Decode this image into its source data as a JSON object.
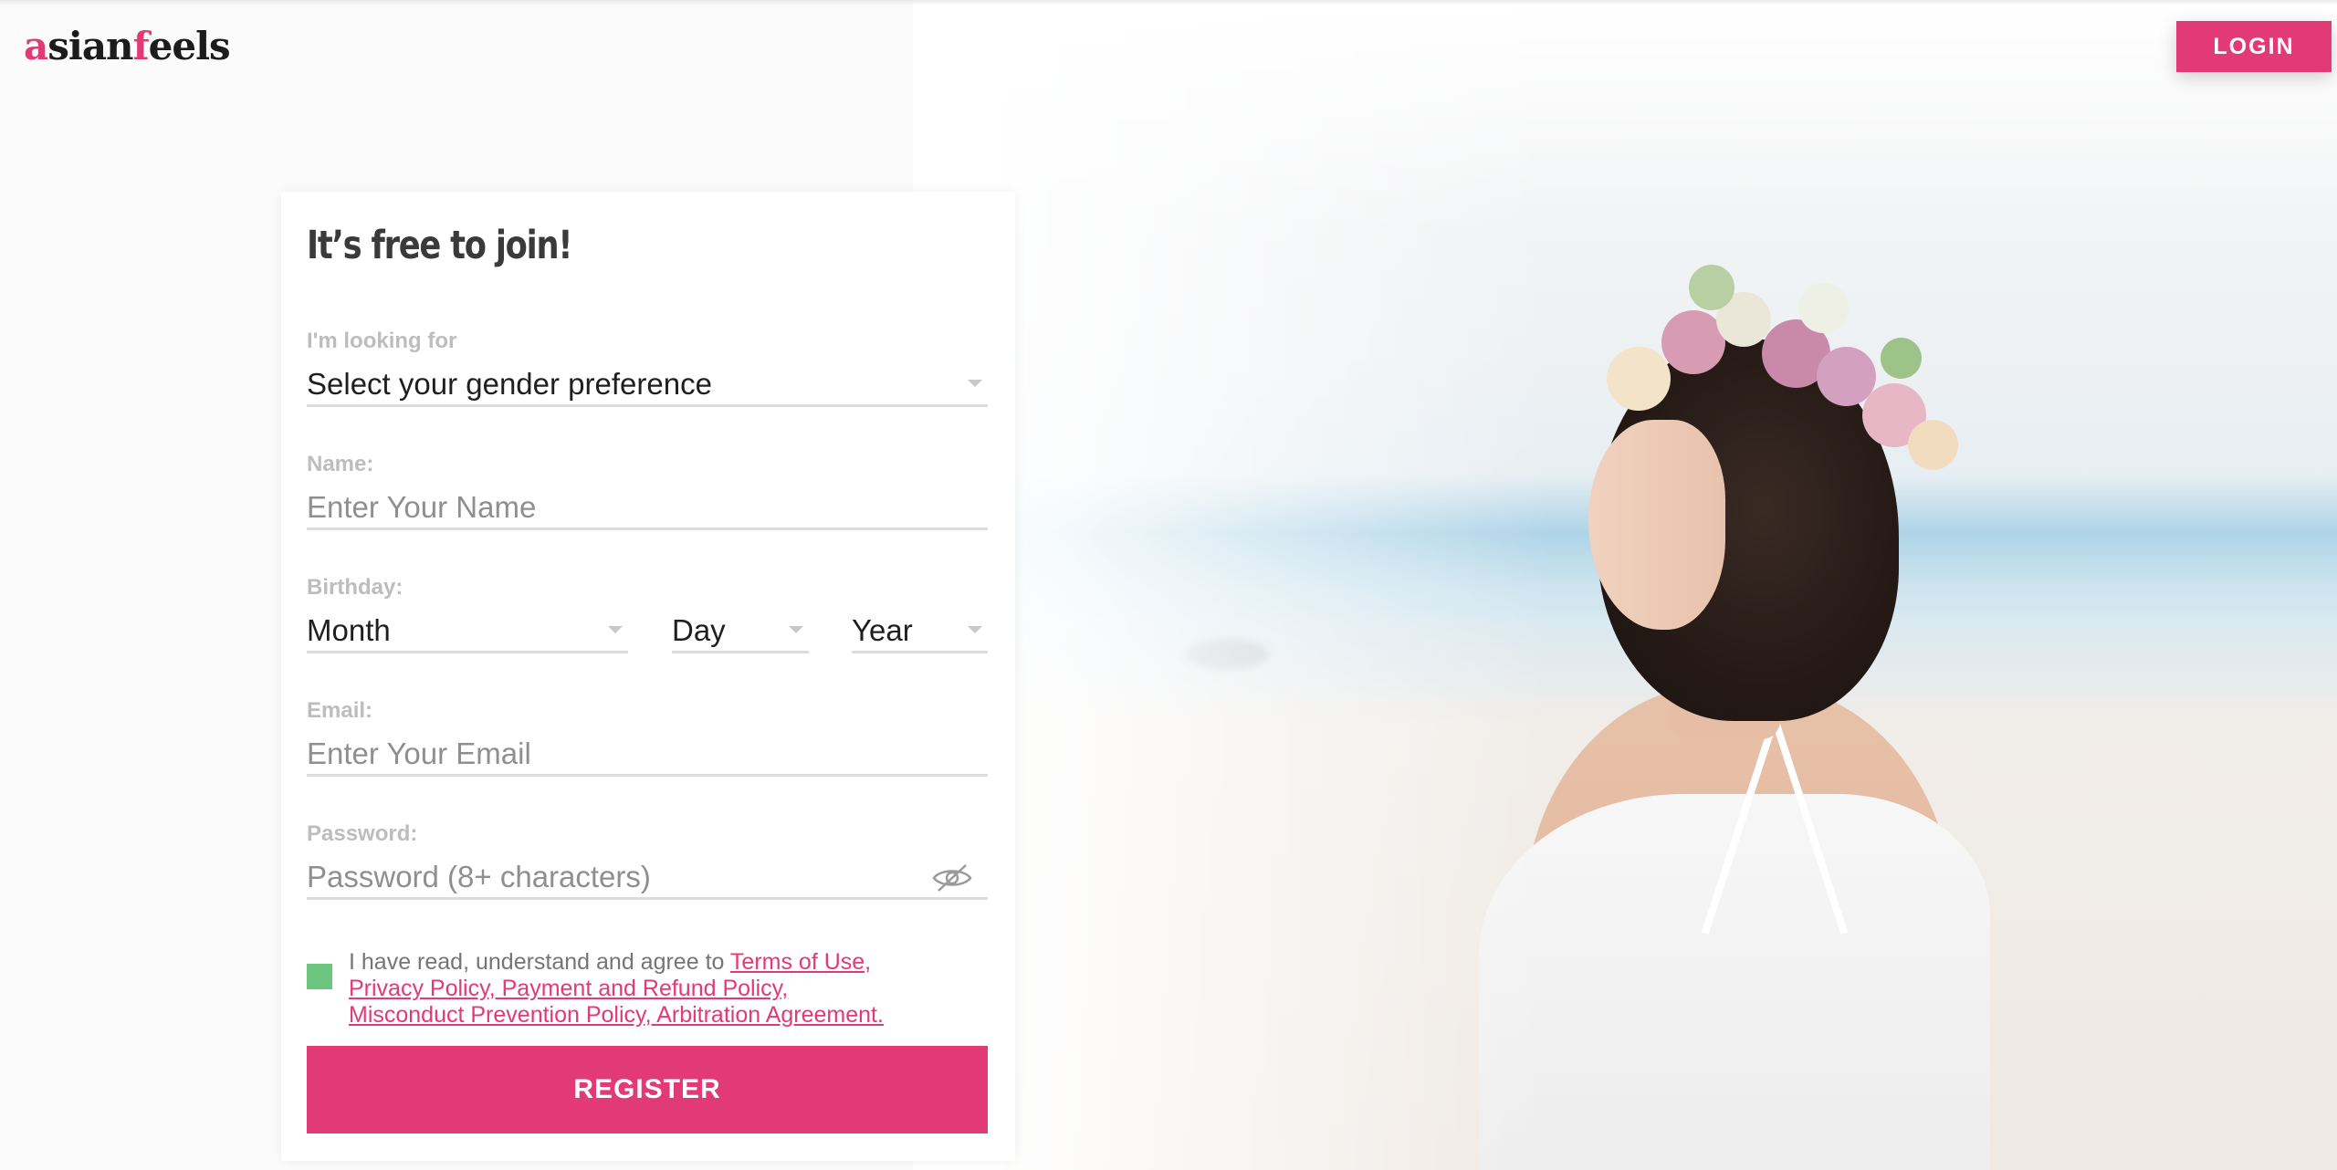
{
  "header": {
    "logo_a": "a",
    "logo_sian": "sian",
    "logo_f": "f",
    "logo_eels": "eels",
    "login_label": "LOGIN"
  },
  "form": {
    "title": "It’s free to join!",
    "looking_for": {
      "label": "I'm looking for",
      "value": "Select your gender preference"
    },
    "name": {
      "label": "Name:",
      "placeholder": "Enter Your Name"
    },
    "birthday": {
      "label": "Birthday:",
      "month": "Month",
      "day": "Day",
      "year": "Year"
    },
    "email": {
      "label": "Email:",
      "placeholder": "Enter Your Email"
    },
    "password": {
      "label": "Password:",
      "placeholder": "Password (8+ characters)"
    },
    "agree": {
      "prefix": "I have read, understand and agree to ",
      "terms": "Terms of Use,",
      "privacy": "Privacy Policy, Payment and Refund Policy,",
      "misconduct": "Misconduct Prevention Policy, Arbitration Agreement."
    },
    "register_label": "REGISTER"
  },
  "colors": {
    "accent": "#e23a74",
    "checkbox": "#6cc57f",
    "label_gray": "#bdbdbd",
    "line_gray": "#dcdcdc"
  },
  "icons": [
    "chevron-down-icon",
    "eye-slash-icon",
    "checkbox-icon"
  ]
}
